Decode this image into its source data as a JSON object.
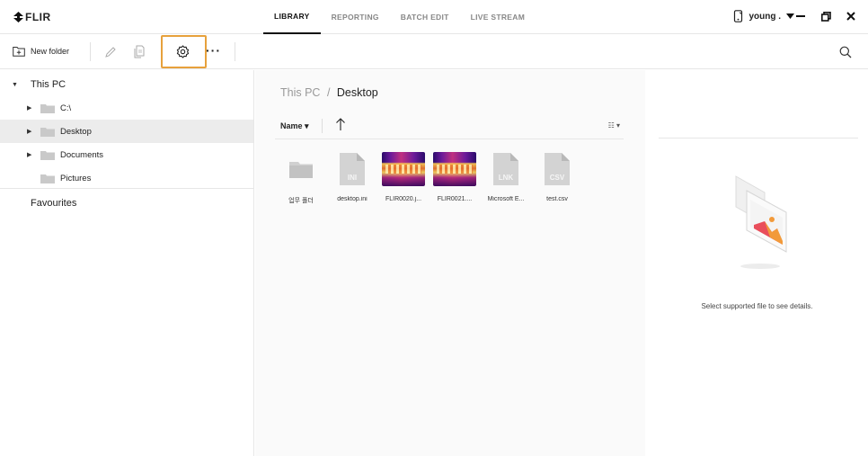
{
  "app": {
    "logo_text": "FLIR",
    "tabs": [
      "LIBRARY",
      "REPORTING",
      "BATCH EDIT",
      "LIVE STREAM"
    ],
    "active_tab": "LIBRARY",
    "user_name": "young ."
  },
  "toolbar": {
    "new_folder_label": "New folder",
    "more_label": "···"
  },
  "tree": {
    "root_label": "This PC",
    "items": [
      {
        "label": "C:\\",
        "has_children": true,
        "selected": false
      },
      {
        "label": "Desktop",
        "has_children": true,
        "selected": true
      },
      {
        "label": "Documents",
        "has_children": true,
        "selected": false
      },
      {
        "label": "Pictures",
        "has_children": false,
        "selected": false
      }
    ],
    "favourites_label": "Favourites"
  },
  "main": {
    "breadcrumb_root": "This PC",
    "breadcrumb_sep": "/",
    "breadcrumb_current": "Desktop",
    "sort_label": "Name ▾",
    "view_toggle": "☷ ▾",
    "files": [
      {
        "name": "업무 폴더",
        "type": "folder"
      },
      {
        "name": "desktop.ini",
        "type": "doc",
        "badge": "INI"
      },
      {
        "name": "FLIR0020.j...",
        "type": "thermal"
      },
      {
        "name": "FLIR0021....",
        "type": "thermal"
      },
      {
        "name": "Microsoft E...",
        "type": "doc",
        "badge": "LNK"
      },
      {
        "name": "test.csv",
        "type": "doc",
        "badge": "CSV"
      }
    ]
  },
  "details": {
    "message": "Select supported file to see details."
  },
  "colors": {
    "highlight": "#e7a13c",
    "selected_row": "#ececec"
  }
}
